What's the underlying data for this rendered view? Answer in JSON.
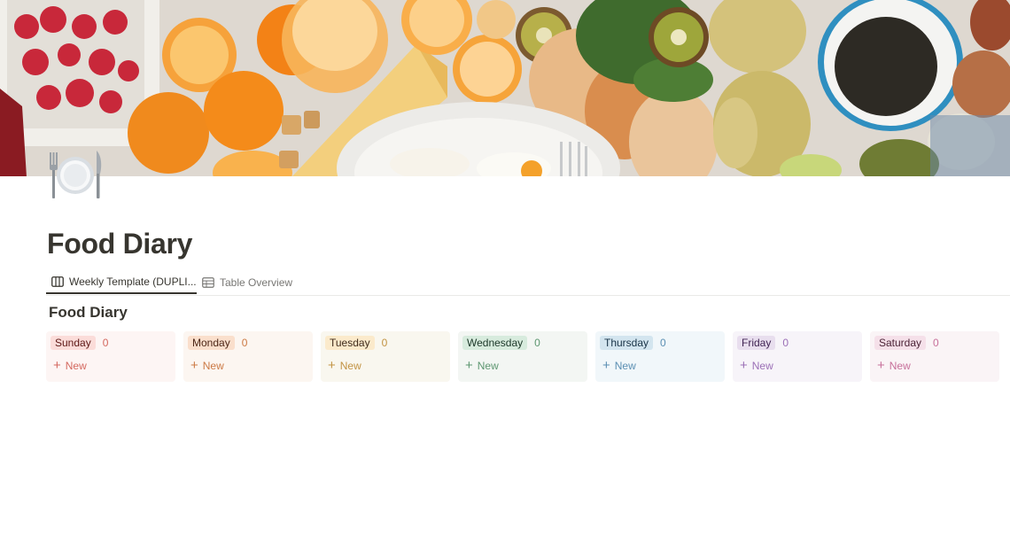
{
  "cover": {
    "description_icon": "breakfast-food-photo"
  },
  "page": {
    "icon": "plate-cutlery-icon",
    "title": "Food Diary"
  },
  "tabs": [
    {
      "label": "Weekly Template (DUPLI...",
      "icon": "board-view-icon",
      "active": true
    },
    {
      "label": "Table Overview",
      "icon": "table-view-icon",
      "active": false
    }
  ],
  "database": {
    "title": "Food Diary",
    "new_label": "New",
    "columns": [
      {
        "name": "Sunday",
        "count": "0",
        "bg": "#fdf5f4",
        "pill_bg": "#fbdcd9",
        "pill_fg": "#5d1715",
        "accent": "#d4685f"
      },
      {
        "name": "Monday",
        "count": "0",
        "bg": "#fcf6f1",
        "pill_bg": "#fadfcc",
        "pill_fg": "#4c2616",
        "accent": "#cc7a45"
      },
      {
        "name": "Tuesday",
        "count": "0",
        "bg": "#f9f7ef",
        "pill_bg": "#fbeacb",
        "pill_fg": "#402c1b",
        "accent": "#c29343"
      },
      {
        "name": "Wednesday",
        "count": "0",
        "bg": "#f3f6f3",
        "pill_bg": "#d7ebdd",
        "pill_fg": "#1c3829",
        "accent": "#5d9670"
      },
      {
        "name": "Thursday",
        "count": "0",
        "bg": "#f1f7fa",
        "pill_bg": "#d3e5ef",
        "pill_fg": "#183347",
        "accent": "#5b8fb3"
      },
      {
        "name": "Friday",
        "count": "0",
        "bg": "#f7f4f9",
        "pill_bg": "#e8deee",
        "pill_fg": "#412454",
        "accent": "#9b6fb6"
      },
      {
        "name": "Saturday",
        "count": "0",
        "bg": "#faf4f6",
        "pill_bg": "#f5e0e9",
        "pill_fg": "#4c2337",
        "accent": "#c7709a"
      }
    ]
  }
}
